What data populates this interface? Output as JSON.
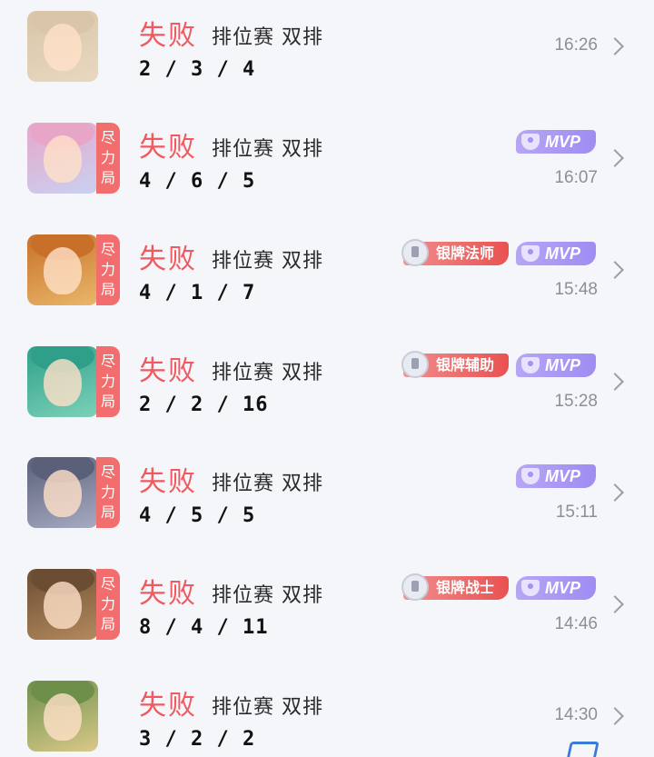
{
  "matches": [
    {
      "result": "失败",
      "mode": "排位赛 双排",
      "kda": "2 / 3 / 4",
      "time": "16:26",
      "effort_tag": null,
      "rank_badge": null,
      "mvp": false,
      "avatar_colors": [
        "#d9c5a8",
        "#e8d8c0"
      ]
    },
    {
      "result": "失败",
      "mode": "排位赛 双排",
      "kda": "4 / 6 / 5",
      "time": "16:07",
      "effort_tag": [
        "尽",
        "力",
        "局"
      ],
      "rank_badge": null,
      "mvp": true,
      "mvp_label": "MVP",
      "avatar_colors": [
        "#e7a6c8",
        "#c9d1f2"
      ]
    },
    {
      "result": "失败",
      "mode": "排位赛 双排",
      "kda": "4 / 1 / 7",
      "time": "15:48",
      "effort_tag": [
        "尽",
        "力",
        "局"
      ],
      "rank_badge": "银牌法师",
      "mvp": true,
      "mvp_label": "MVP",
      "avatar_colors": [
        "#c8702a",
        "#e9b76a"
      ]
    },
    {
      "result": "失败",
      "mode": "排位赛 双排",
      "kda": "2 / 2 / 16",
      "time": "15:28",
      "effort_tag": [
        "尽",
        "力",
        "局"
      ],
      "rank_badge": "银牌辅助",
      "mvp": true,
      "mvp_label": "MVP",
      "avatar_colors": [
        "#2f9f8a",
        "#7cd1b8"
      ]
    },
    {
      "result": "失败",
      "mode": "排位赛 双排",
      "kda": "4 / 5 / 5",
      "time": "15:11",
      "effort_tag": [
        "尽",
        "力",
        "局"
      ],
      "rank_badge": null,
      "mvp": true,
      "mvp_label": "MVP",
      "avatar_colors": [
        "#5b607a",
        "#a7abc2"
      ]
    },
    {
      "result": "失败",
      "mode": "排位赛 双排",
      "kda": "8 / 4 / 11",
      "time": "14:46",
      "effort_tag": [
        "尽",
        "力",
        "局"
      ],
      "rank_badge": "银牌战士",
      "mvp": true,
      "mvp_label": "MVP",
      "avatar_colors": [
        "#6b4d33",
        "#b48a5e"
      ]
    },
    {
      "result": "失败",
      "mode": "排位赛 双排",
      "kda": "3 / 2 / 2",
      "time": "14:30",
      "effort_tag": null,
      "rank_badge": null,
      "mvp": false,
      "avatar_colors": [
        "#6d8f4a",
        "#d9c98a"
      ]
    }
  ],
  "icons": {
    "chevron": "chevron-right-icon",
    "mvp": "trophy-icon",
    "rank": "rank-emblem-icon"
  },
  "colors": {
    "result_loss": "#f0595f",
    "effort_tag": "#f26d6d",
    "mvp_badge": "#a391f3",
    "rank_badge": "#ea5151",
    "background": "#f5f6fa"
  }
}
